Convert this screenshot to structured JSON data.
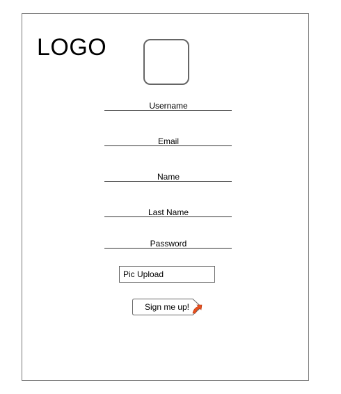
{
  "brand": {
    "logo_text": "LOGO"
  },
  "form": {
    "fields": [
      {
        "label": "Username"
      },
      {
        "label": "Email"
      },
      {
        "label": "Name"
      },
      {
        "label": "Last Name"
      },
      {
        "label": "Password"
      }
    ],
    "upload_label": "Pic Upload",
    "submit_label": "Sign me up!"
  },
  "colors": {
    "border": "#777777",
    "text": "#000000",
    "cursor": "#e8511f"
  }
}
